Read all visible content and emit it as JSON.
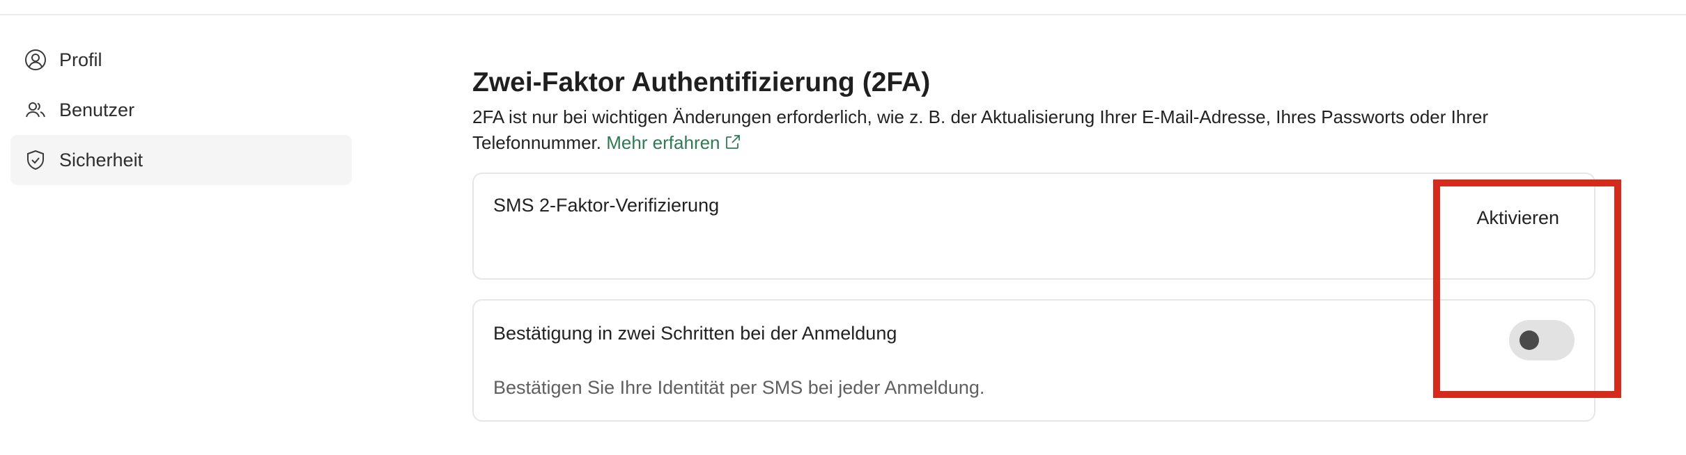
{
  "sidebar": {
    "items": [
      {
        "label": "Profil",
        "icon": "user-circle-icon",
        "active": false
      },
      {
        "label": "Benutzer",
        "icon": "users-icon",
        "active": false
      },
      {
        "label": "Sicherheit",
        "icon": "shield-check-icon",
        "active": true
      }
    ]
  },
  "main": {
    "title": "Zwei-Faktor Authentifizierung (2FA)",
    "description": "2FA ist nur bei wichtigen Änderungen erforderlich, wie z. B. der Aktualisierung Ihrer E-Mail-Adresse, Ihres Passworts oder Ihrer Telefonnummer.",
    "learn_more_label": "Mehr erfahren",
    "learn_more_icon": "external-link-icon",
    "link_color": "#2f7a54",
    "cards": {
      "sms": {
        "title": "SMS 2-Faktor-Verifizierung",
        "action_label": "Aktivieren"
      },
      "two_step": {
        "title": "Bestätigung in zwei Schritten bei der Anmeldung",
        "description": "Bestätigen Sie Ihre Identität per SMS bei jeder Anmeldung.",
        "toggle_on": false
      }
    }
  },
  "highlight": {
    "color": "#d42b1c"
  }
}
